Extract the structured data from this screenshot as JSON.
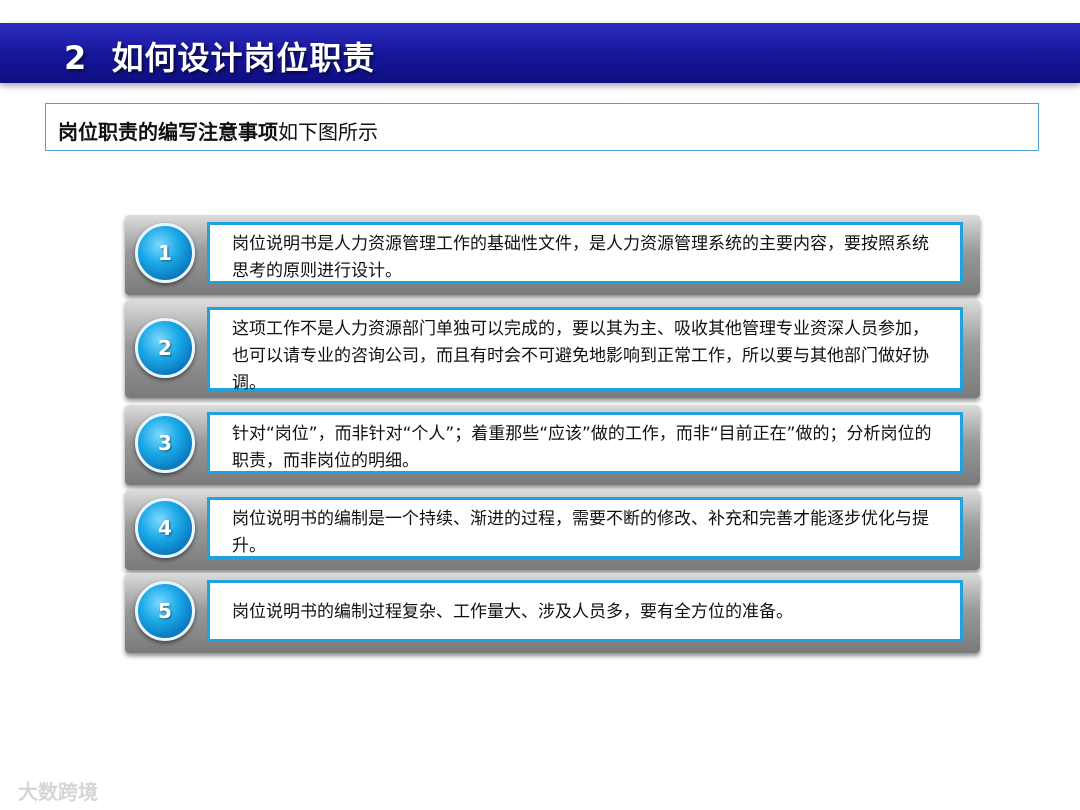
{
  "title": "2  如何设计岗位职责",
  "subtitle": {
    "bold": "岗位职责的编写注意事项",
    "rest": "如下图所示"
  },
  "items": [
    {
      "num": "1",
      "text": "岗位说明书是人力资源管理工作的基础性文件，是人力资源管理系统的主要内容，要按照系统思考的原则进行设计。"
    },
    {
      "num": "2",
      "text": "这项工作不是人力资源部门单独可以完成的，要以其为主、吸收其他管理专业资深人员参加，也可以请专业的咨询公司，而且有时会不可避免地影响到正常工作，所以要与其他部门做好协调。"
    },
    {
      "num": "3",
      "text": "针对“岗位”，而非针对“个人”；着重那些“应该”做的工作，而非“目前正在”做的；分析岗位的职责，而非岗位的明细。"
    },
    {
      "num": "4",
      "text": "岗位说明书的编制是一个持续、渐进的过程，需要不断的修改、补充和完善才能逐步优化与提升。"
    },
    {
      "num": "5",
      "text": "岗位说明书的编制过程复杂、工作量大、涉及人员多，要有全方位的准备。"
    }
  ],
  "watermark": "大数跨境"
}
